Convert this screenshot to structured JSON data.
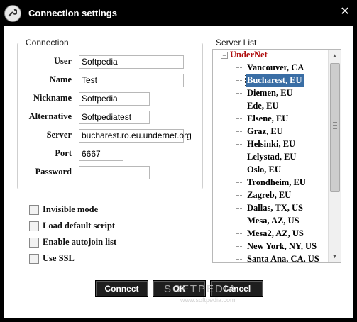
{
  "window": {
    "title": "Connection settings",
    "close_label": "✕"
  },
  "connection": {
    "legend": "Connection",
    "fields": [
      {
        "label": "User",
        "value": "Softpedia"
      },
      {
        "label": "Name",
        "value": "Test"
      },
      {
        "label": "Nickname",
        "value": "Softpedia"
      },
      {
        "label": "Alternative",
        "value": "Softpediatest"
      },
      {
        "label": "Server",
        "value": "bucharest.ro.eu.undernet.org"
      },
      {
        "label": "Port",
        "value": "6667"
      },
      {
        "label": "Password",
        "value": ""
      }
    ]
  },
  "options": [
    {
      "label": "Invisible mode",
      "checked": false
    },
    {
      "label": "Load default script",
      "checked": false
    },
    {
      "label": "Enable autojoin list",
      "checked": false
    },
    {
      "label": "Use SSL",
      "checked": false
    }
  ],
  "server_list": {
    "legend": "Server List",
    "network": "UnderNet",
    "expander": "−",
    "servers": [
      "Vancouver, CA",
      "Bucharest, EU",
      "Diemen, EU",
      "Ede, EU",
      "Elsene, EU",
      "Graz, EU",
      "Helsinki, EU",
      "Lelystad, EU",
      "Oslo, EU",
      "Trondheim, EU",
      "Zagreb, EU",
      "Dallas, TX, US",
      "Mesa, AZ, US",
      "Mesa2, AZ, US",
      "New York, NY, US",
      "Santa Ana, CA, US"
    ],
    "selected": "Bucharest, EU",
    "scroll_up": "▲",
    "scroll_down": "▼"
  },
  "buttons": {
    "connect": "Connect",
    "ok": "OK",
    "cancel": "Cancel"
  },
  "watermark": {
    "text": "SOFTPEDIA",
    "url": "www.softpedia.com"
  },
  "colors": {
    "selection": "#3a6ea5",
    "network": "#b01010",
    "button_bg": "#1e1e1e"
  }
}
